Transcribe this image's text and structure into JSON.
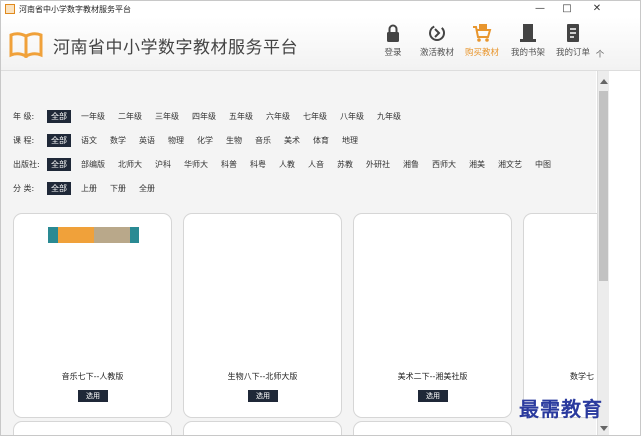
{
  "window": {
    "title": "河南省中小学数字教材服务平台"
  },
  "header": {
    "brand": "河南省中小学数字教材服务平台",
    "nav": [
      {
        "label": "登录",
        "icon": "lock-icon"
      },
      {
        "label": "激活教材",
        "icon": "activate-icon"
      },
      {
        "label": "购买教材",
        "icon": "cart-icon",
        "active": true
      },
      {
        "label": "我的书架",
        "icon": "bookshelf-icon"
      },
      {
        "label": "我的订单",
        "icon": "orders-icon"
      }
    ],
    "nav_overflow": "个"
  },
  "filters": {
    "grade": {
      "label": "年    级:",
      "options": [
        "全部",
        "一年级",
        "二年级",
        "三年级",
        "四年级",
        "五年级",
        "六年级",
        "七年级",
        "八年级",
        "九年级"
      ]
    },
    "subject": {
      "label": "课    程:",
      "options": [
        "全部",
        "语文",
        "数学",
        "英语",
        "物理",
        "化学",
        "生物",
        "音乐",
        "美术",
        "体育",
        "地理"
      ]
    },
    "publisher": {
      "label": "出版社:",
      "options": [
        "全部",
        "部编版",
        "北师大",
        "沪科",
        "华师大",
        "科普",
        "科粤",
        "人教",
        "人音",
        "苏教",
        "外研社",
        "湘鲁",
        "西师大",
        "湘美",
        "湘文艺",
        "中图"
      ]
    },
    "volume": {
      "label": "分    类:",
      "options": [
        "全部",
        "上册",
        "下册",
        "全册"
      ]
    }
  },
  "books": [
    {
      "title": "音乐七下--人教版",
      "button": "选用"
    },
    {
      "title": "生物八下--北师大版",
      "button": "选用"
    },
    {
      "title": "美术二下--湘美社版",
      "button": "选用"
    },
    {
      "title": "数学七",
      "button": ""
    }
  ],
  "watermark": "最需教育",
  "colors": {
    "accent": "#e8962e",
    "selected": "#1f2838",
    "cover_teal": "#2a8a93",
    "cover_orange": "#f0a13a"
  }
}
